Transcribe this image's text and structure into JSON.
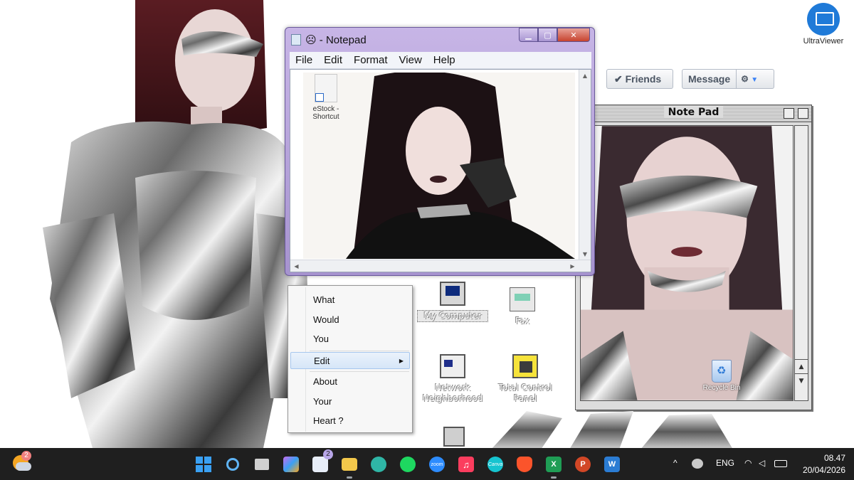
{
  "desktop": {
    "top_icon": {
      "label": "UltraViewer",
      "icon": "ultraviewer-icon"
    },
    "recycle_bin": {
      "label": "Recycle Bin",
      "icon": "recycle-bin-icon"
    },
    "retro_icons": [
      {
        "label": "My Computer",
        "icon": "computer-icon"
      },
      {
        "label": "Fax",
        "icon": "fax-icon"
      },
      {
        "label": "Network Neighborhood",
        "icon": "network-icon"
      },
      {
        "label": "Total Control Panel",
        "icon": "control-panel-icon"
      },
      {
        "label": "",
        "icon": "retro-recycle-bin-icon"
      }
    ]
  },
  "social": {
    "friends_label": "✔ Friends",
    "message_label": "Message",
    "gear_icon": "gear-icon",
    "caret_icon": "caret-down-icon"
  },
  "notepad": {
    "title": "☹ - Notepad",
    "menu": [
      "File",
      "Edit",
      "Format",
      "View",
      "Help"
    ],
    "shortcut": {
      "label": "eStock - Shortcut",
      "icon": "document-shortcut-icon"
    },
    "controls": {
      "min": "▁",
      "max": "▢",
      "close": "✕"
    }
  },
  "mac_notepad": {
    "title": "Note Pad"
  },
  "context_menu": {
    "items": [
      "What",
      "Would",
      "You",
      "Edit",
      "About",
      "Your",
      "Heart ?"
    ],
    "highlighted": "Edit",
    "submenu_arrow": "▶"
  },
  "taskbar": {
    "weather_badge": "2",
    "apps": [
      {
        "name": "start",
        "icon": "windows-start-icon",
        "color": "#3aa0f3"
      },
      {
        "name": "search",
        "icon": "search-icon",
        "color": "#5fb4f5"
      },
      {
        "name": "task-view",
        "icon": "task-view-icon",
        "color": "#d0d0d0"
      },
      {
        "name": "copilot",
        "icon": "copilot-icon",
        "color": "#c76cf0"
      },
      {
        "name": "store",
        "icon": "store-icon",
        "color": "#e8eef8",
        "badge": "2"
      },
      {
        "name": "explorer",
        "icon": "folder-icon",
        "color": "#f3c84b",
        "open": true
      },
      {
        "name": "edge",
        "icon": "edge-icon",
        "color": "#2fb6a6"
      },
      {
        "name": "spotify",
        "icon": "spotify-icon",
        "color": "#1ed760"
      },
      {
        "name": "zoom",
        "icon": "zoom-icon",
        "color": "#2d8cff",
        "text": "zoom"
      },
      {
        "name": "music",
        "icon": "music-icon",
        "color": "#fb3d5e"
      },
      {
        "name": "canva",
        "icon": "canva-icon",
        "color": "#16c4d0",
        "text": "Canva"
      },
      {
        "name": "brave",
        "icon": "brave-icon",
        "color": "#fb542b"
      },
      {
        "name": "excel",
        "icon": "excel-icon",
        "color": "#1f9d55",
        "open": true
      },
      {
        "name": "powerpoint",
        "icon": "powerpoint-icon",
        "color": "#d24726"
      },
      {
        "name": "word",
        "icon": "word-icon",
        "color": "#2b7cd3"
      }
    ],
    "tray": {
      "chevron": "^",
      "language": "ENG",
      "wifi_icon": "wifi-icon",
      "volume_icon": "volume-icon",
      "battery_icon": "battery-icon",
      "time": "08.47",
      "date": "20/04/2026"
    }
  }
}
